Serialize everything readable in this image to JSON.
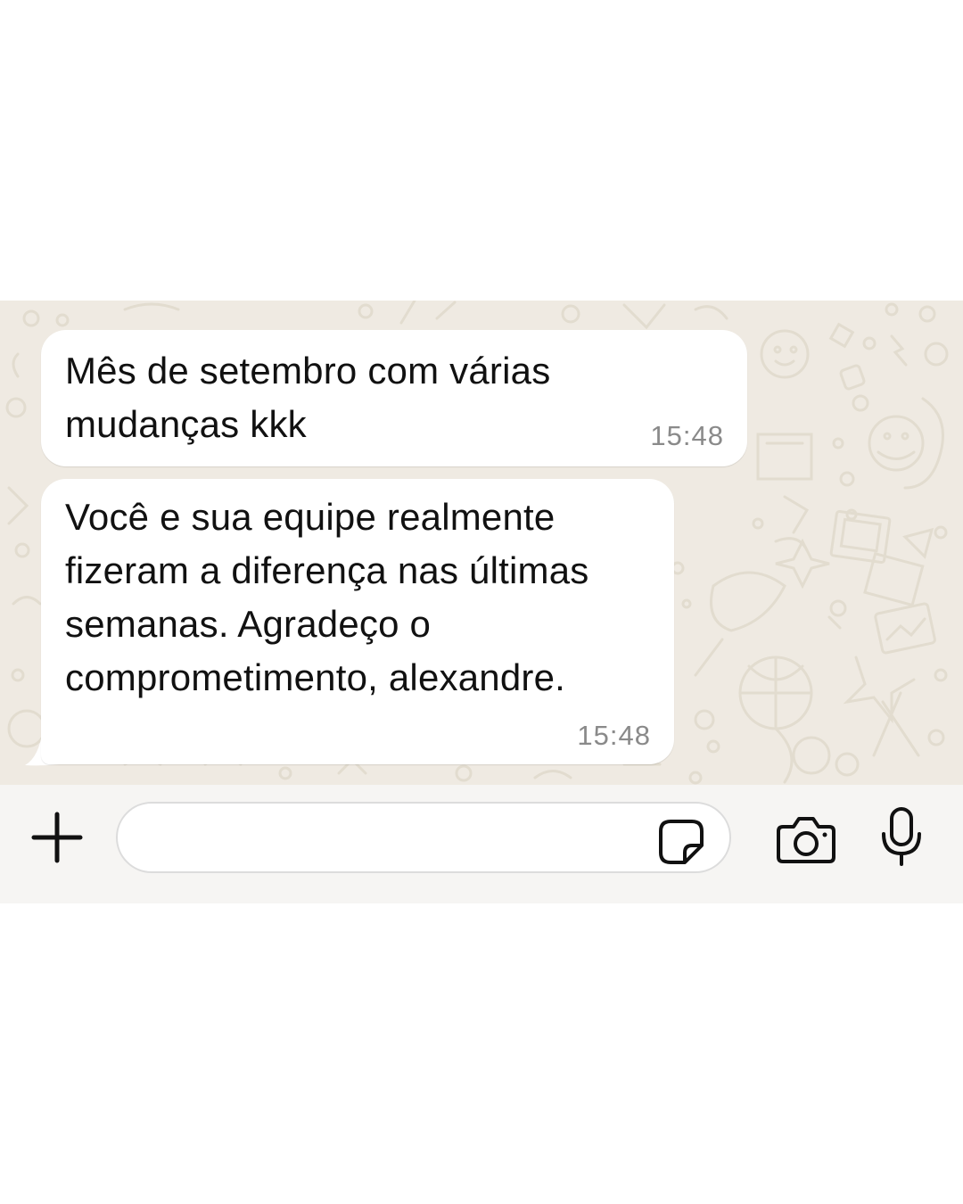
{
  "chat": {
    "messages": [
      {
        "text": "Mês de setembro com várias\nmudanças kkk",
        "time": "15:48"
      },
      {
        "text": "Você e sua equipe realmente\nfizeram a diferença nas últimas\nsemanas. Agradeço o\ncomprometimento, alexandre.",
        "time": "15:48"
      }
    ]
  },
  "input_bar": {
    "placeholder": "",
    "icons": [
      "plus-icon",
      "sticker-icon",
      "camera-icon",
      "mic-icon"
    ]
  },
  "colors": {
    "chat_background": "#efeae2",
    "bubble": "#ffffff",
    "input_bar_background": "#f6f5f3",
    "timestamp": "#8a8a8a"
  }
}
